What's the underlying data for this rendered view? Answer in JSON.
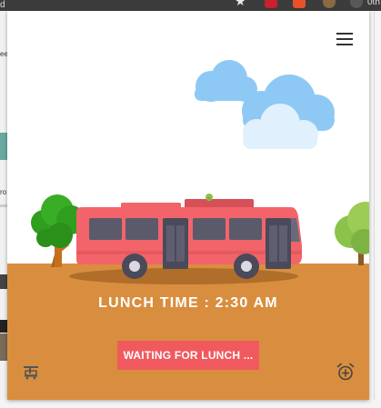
{
  "browser": {
    "star_glyph": "★",
    "partial_tab_text": "0th",
    "left_text": "d",
    "left_text_2": "ee",
    "left_text_3": "ro"
  },
  "popup": {
    "menu_icon": "hamburger-menu-icon",
    "scene": {
      "clouds": "cloud-illustration",
      "trees": "tree-illustration",
      "bus": "bus-illustration"
    },
    "lunch_time_label": "LUNCH TIME : 2:30 AM",
    "waiting_button_label": "WAITING FOR LUNCH ...",
    "bottom_left_icon": "bus-stop-icon",
    "bottom_right_icon": "add-alarm-icon"
  },
  "colors": {
    "ground": "#d98e3f",
    "bus_body": "#f2646a",
    "button": "#f05a5f",
    "cloud_blue": "#8ec9f5",
    "cloud_light": "#e0f0fc"
  }
}
